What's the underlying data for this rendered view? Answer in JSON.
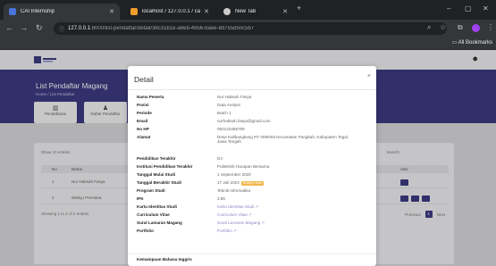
{
  "browser": {
    "tabs": [
      {
        "label": "CAI Internship",
        "active": true
      },
      {
        "label": "localhost / 127.0.0.1 / cai-intern",
        "active": false
      },
      {
        "label": "New Tab",
        "active": false
      }
    ],
    "url_host": "127.0.0.1",
    "url_path": ":8000/list-pendaftar/detail/38c31b1e-a9eb-4956-baee-8d755d50c5b7",
    "bookmarks_label": "All Bookmarks"
  },
  "colors": {
    "brand": "#3c3b82",
    "badge": "#f1b84d",
    "link": "#8a89c8"
  },
  "page": {
    "title": "List Pendaftar Magang",
    "breadcrumb": "Home  /  List Pendaftar",
    "stats": [
      {
        "icon": "chart-icon",
        "label": "Pendaftaran"
      },
      {
        "icon": "user-icon",
        "label": "Daftar Pendaftar"
      }
    ],
    "filter_label": "Show  10  entries",
    "search_label": "Search:",
    "table": {
      "columns": [
        "No",
        "Nama",
        "Aksi"
      ],
      "rows": [
        {
          "no": "1",
          "nama": "Nur Habsah Fasya"
        },
        {
          "no": "2",
          "nama": "Wahyu Permana"
        }
      ]
    },
    "showing": "Showing 1 to 2 of 2 entries",
    "pager": {
      "prev": "Previous",
      "page": "1",
      "next": "Next"
    }
  },
  "modal": {
    "title": "Detail",
    "close": "×",
    "fields": [
      {
        "label": "Nama Peserta",
        "value": "Nur Habsah Fasya"
      },
      {
        "label": "Posisi",
        "value": "Data Analyst"
      },
      {
        "label": "Periode",
        "value": "Batch 1"
      },
      {
        "label": "Email",
        "value": "nurhabsah.fasya@gmail.com"
      },
      {
        "label": "No HP",
        "value": "082123456789"
      },
      {
        "label": "Alamat",
        "value": "Desa Kalibangkang RT 005/003 Kecamatan Pangkah, Kabupaten Tegal, Jawa Tengah"
      },
      {
        "label": "Pendidikan Terakhir",
        "value": "D4"
      },
      {
        "label": "Institusi Pendidikan Terakhir",
        "value": "Politeknik Harapan Bersama"
      },
      {
        "label": "Tanggal Mulai Studi",
        "value": "1 September 2020"
      },
      {
        "label": "Tanggal Berakhir Studi",
        "value": "17 Juli 2024",
        "badge": "Sudah Lulus"
      },
      {
        "label": "Program Studi",
        "value": "Teknik Informatika"
      },
      {
        "label": "IPK",
        "value": "3.85"
      },
      {
        "label": "Kartu Identitas Studi",
        "value": "Kartu Identitas Studi",
        "link": true
      },
      {
        "label": "Curriculum Vitae",
        "value": "Curriculum Vitae",
        "link": true
      },
      {
        "label": "Surat Lamaran Magang",
        "value": "Surat Lamaran Magang",
        "link": true
      },
      {
        "label": "Portfolio",
        "value": "Portfolio",
        "link": true
      }
    ],
    "footer_label": "Kemampuan Bahasa Inggris"
  }
}
